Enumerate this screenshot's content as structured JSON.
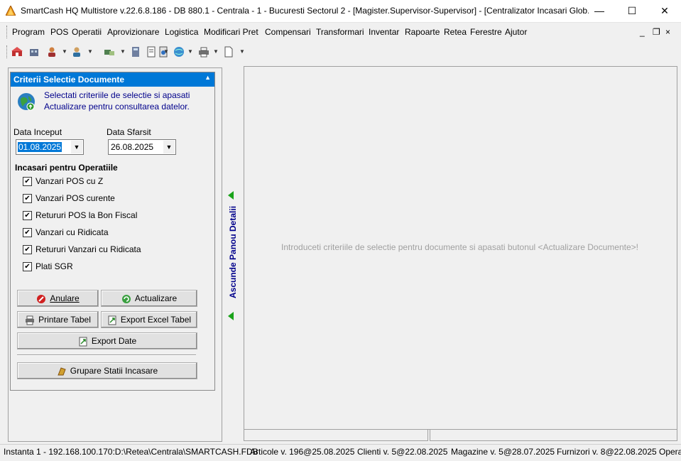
{
  "window": {
    "title": "SmartCash HQ Multistore v.22.6.8.186 - DB 880.1 - Centrala - 1 - Bucuresti Sectorul 2 - [Magister.Supervisor-Supervisor] - [Centralizator Incasari Glob...",
    "controls": {
      "minimize": "—",
      "maximize": "☐",
      "close": "✕"
    }
  },
  "menu": {
    "items": [
      "Program",
      "POS",
      "Operatii",
      "Aprovizionare",
      "Logistica",
      "Modificari Pret",
      "Compensari",
      "Transformari",
      "Inventar",
      "Rapoarte",
      "Retea",
      "Ferestre",
      "Ajutor"
    ],
    "mdi": {
      "minimize": "_",
      "restore": "❐",
      "close": "×"
    }
  },
  "panel": {
    "header": "Criterii Selectie Documente",
    "collapse": "▲",
    "info_line1": "Selectati criteriile de selectie si apasati",
    "info_line2": "Actualizare pentru consultarea datelor.",
    "start_label": "Data Inceput",
    "start_value": "01.08.2025",
    "end_label": "Data Sfarsit",
    "end_value": "26.08.2025",
    "dropdown": "▼",
    "section": "Incasari pentru Operatiile",
    "check": "✔",
    "options": [
      {
        "label": "Vanzari POS cu Z",
        "checked": true
      },
      {
        "label": "Vanzari POS curente",
        "checked": true
      },
      {
        "label": "Retururi POS la Bon Fiscal",
        "checked": true
      },
      {
        "label": "Vanzari cu Ridicata",
        "checked": true
      },
      {
        "label": "Retururi Vanzari cu Ridicata",
        "checked": true
      },
      {
        "label": "Plati SGR",
        "checked": true
      }
    ],
    "buttons": {
      "cancel": "Anulare",
      "refresh": "Actualizare",
      "print": "Printare Tabel",
      "excel": "Export Excel Tabel",
      "export": "Export Date",
      "group": "Grupare Statii Incasare"
    }
  },
  "splitter": {
    "label": "Ascunde Panou Detalii"
  },
  "main": {
    "placeholder": "Introduceti criteriile de selectie pentru documente si apasati butonul <Actualizare Documente>!"
  },
  "status": {
    "instance": "Instanta 1 - 192.168.100.170:D:\\Retea\\Centrala\\SMARTCASH.FDB",
    "articole": "Articole v. 196@25.08.2025",
    "clienti": "Clienti v. 5@22.08.2025",
    "magazine": "Magazine v. 5@28.07.2025",
    "furnizori": "Furnizori v. 8@22.08.2025",
    "operatii": "Opera"
  }
}
